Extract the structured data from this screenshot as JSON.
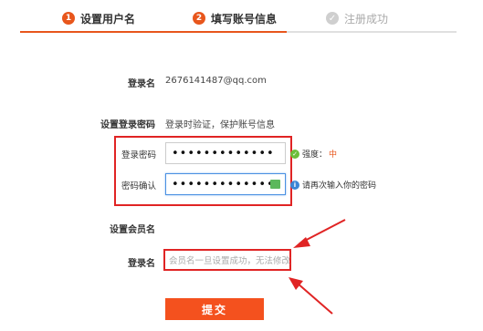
{
  "steps": [
    {
      "number": "1",
      "label": "设置用户名"
    },
    {
      "number": "2",
      "label": "填写账号信息"
    },
    {
      "label": "注册成功"
    }
  ],
  "colors": {
    "accent": "#e8561c",
    "annotation_red": "#e02424",
    "submit": "#f4511e"
  },
  "login": {
    "label": "登录名",
    "value": "2676141487@qq.com"
  },
  "password_section": {
    "label": "设置登录密码",
    "desc": "登录时验证，保护账号信息"
  },
  "password": {
    "label": "登录密码",
    "value": "•••••••••••••",
    "strength_label": "强度：",
    "strength_value": "中"
  },
  "confirm": {
    "label": "密码确认",
    "value": "•••••••••••••",
    "hint": "请再次输入你的密码"
  },
  "member_section": {
    "label": "设置会员名"
  },
  "member": {
    "label": "登录名",
    "placeholder": "会员名一旦设置成功，无法修改"
  },
  "submit_label": "提交",
  "icons": {
    "success": "check-circle-icon",
    "info": "info-circle-icon",
    "keyboard": "keyboard-icon"
  }
}
